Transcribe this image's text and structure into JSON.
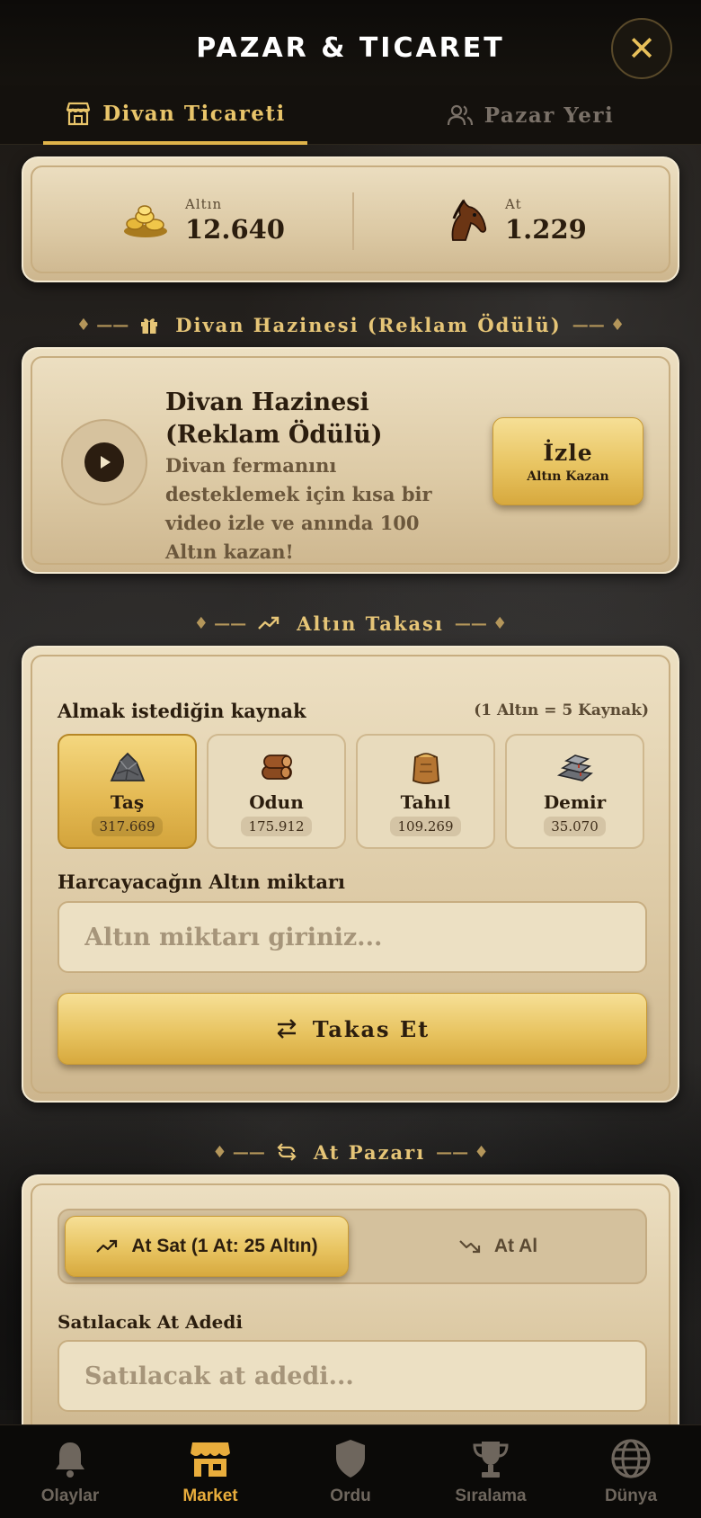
{
  "header": {
    "title": "PAZAR & TICARET",
    "close_label": "✕"
  },
  "tabs": [
    {
      "label": "Divan Ticareti",
      "icon": "store-icon",
      "active": true
    },
    {
      "label": "Pazar Yeri",
      "icon": "users-icon",
      "active": false
    }
  ],
  "resources": {
    "gold": {
      "label": "Altın",
      "value": "12.640",
      "icon": "gold-coins-icon"
    },
    "horse": {
      "label": "At",
      "value": "1.229",
      "icon": "horse-icon"
    }
  },
  "ad_section": {
    "heading": "Divan Hazinesi (Reklam Ödülü)",
    "title": "Divan Hazinesi (Reklam Ödülü)",
    "description": "Divan fermanını desteklemek için kısa bir video izle ve anında 100 Altın kazan!",
    "button_label": "İzle",
    "button_sublabel": "Altın Kazan"
  },
  "trade_section": {
    "heading": "Altın Takası",
    "resource_label": "Almak istediğin kaynak",
    "rate": "(1 Altın = 5 Kaynak)",
    "options": [
      {
        "name": "Taş",
        "amount": "317.669",
        "selected": true,
        "icon": "stone-icon"
      },
      {
        "name": "Odun",
        "amount": "175.912",
        "selected": false,
        "icon": "wood-icon"
      },
      {
        "name": "Tahıl",
        "amount": "109.269",
        "selected": false,
        "icon": "grain-icon"
      },
      {
        "name": "Demir",
        "amount": "35.070",
        "selected": false,
        "icon": "iron-icon"
      }
    ],
    "amount_label": "Harcayacağın Altın miktarı",
    "amount_placeholder": "Altın miktarı giriniz...",
    "amount_value": "",
    "swap_button": "Takas Et"
  },
  "horse_section": {
    "heading": "At Pazarı",
    "sell_tab": "At Sat (1 At: 25 Altın)",
    "buy_tab": "At Al",
    "active_tab": "sell",
    "count_label": "Satılacak At Adedi",
    "count_placeholder": "Satılacak at adedi...",
    "count_value": ""
  },
  "bottom_nav": [
    {
      "label": "Olaylar",
      "icon": "bell-icon",
      "active": false
    },
    {
      "label": "Market",
      "icon": "market-icon",
      "active": true
    },
    {
      "label": "Ordu",
      "icon": "shield-icon",
      "active": false
    },
    {
      "label": "Sıralama",
      "icon": "trophy-icon",
      "active": false
    },
    {
      "label": "Dünya",
      "icon": "globe-icon",
      "active": false
    }
  ],
  "colors": {
    "accent_gold": "#e0b44a",
    "card_bg": "#e6d6b4",
    "nav_active": "#e9ad3c",
    "nav_inactive": "#6e665d",
    "text_dark": "#2b1d0e"
  }
}
